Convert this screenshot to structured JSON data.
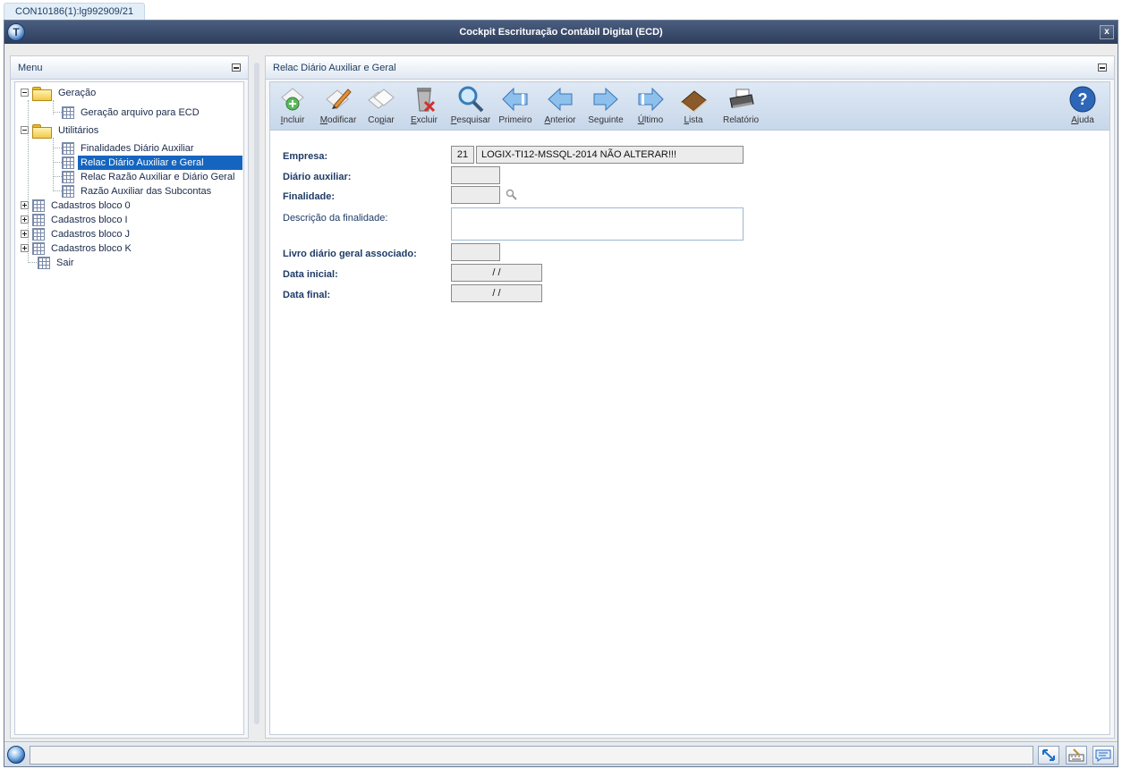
{
  "tab": {
    "label": "CON10186(1):lg992909/21"
  },
  "window": {
    "title": "Cockpit Escrituração Contábil Digital (ECD)",
    "close_label": "x"
  },
  "menu": {
    "title": "Menu",
    "items": [
      {
        "label": "Geração"
      },
      {
        "label": "Geração arquivo para ECD"
      },
      {
        "label": "Utilitários"
      },
      {
        "label": "Finalidades Diário Auxiliar"
      },
      {
        "label": "Relac Diário Auxiliar e Geral"
      },
      {
        "label": "Relac Razão Auxiliar e Diário Geral"
      },
      {
        "label": "Razão Auxiliar das Subcontas"
      },
      {
        "label": "Cadastros bloco 0"
      },
      {
        "label": "Cadastros bloco I"
      },
      {
        "label": "Cadastros bloco J"
      },
      {
        "label": "Cadastros bloco K"
      },
      {
        "label": "Sair"
      }
    ],
    "selected": "Relac Diário Auxiliar e Geral"
  },
  "main": {
    "title": "Relac Diário Auxiliar e Geral",
    "toolbar": [
      {
        "pre": "",
        "u": "I",
        "post": "ncluir",
        "icon": "add-icon"
      },
      {
        "pre": "",
        "u": "M",
        "post": "odificar",
        "icon": "edit-icon"
      },
      {
        "pre": "Co",
        "u": "p",
        "post": "iar",
        "icon": "copy-icon"
      },
      {
        "pre": "",
        "u": "E",
        "post": "xcluir",
        "icon": "delete-icon"
      },
      {
        "pre": "",
        "u": "P",
        "post": "esquisar",
        "icon": "search-icon"
      },
      {
        "pre": "",
        "u": "",
        "post": "Primeiro",
        "icon": "first-icon"
      },
      {
        "pre": "",
        "u": "A",
        "post": "nterior",
        "icon": "previous-icon"
      },
      {
        "pre": "Se",
        "u": "g",
        "post": "uinte",
        "icon": "next-icon"
      },
      {
        "pre": "",
        "u": "Ú",
        "post": "ltimo",
        "icon": "last-icon"
      },
      {
        "pre": "",
        "u": "L",
        "post": "ista",
        "icon": "list-icon"
      },
      {
        "pre": "",
        "u": "",
        "post": "Relatório",
        "icon": "report-icon"
      },
      {
        "pre": "",
        "u": "A",
        "post": "juda",
        "icon": "help-icon"
      }
    ],
    "form": {
      "empresa_label": "Empresa:",
      "empresa_code": "21",
      "empresa_name": "LOGIX-TI12-MSSQL-2014 NÃO ALTERAR!!!",
      "diario_label": "Diário auxiliar:",
      "diario_value": "",
      "finalidade_label": "Finalidade:",
      "finalidade_value": "",
      "descricao_label": "Descrição da finalidade:",
      "descricao_value": "",
      "livro_label": "Livro diário geral associado:",
      "livro_value": "",
      "data_inicial_label": "Data inicial:",
      "data_inicial_value": "/ /",
      "data_final_label": "Data final:",
      "data_final_value": "/ /"
    }
  },
  "statusbar": {
    "text": ""
  }
}
